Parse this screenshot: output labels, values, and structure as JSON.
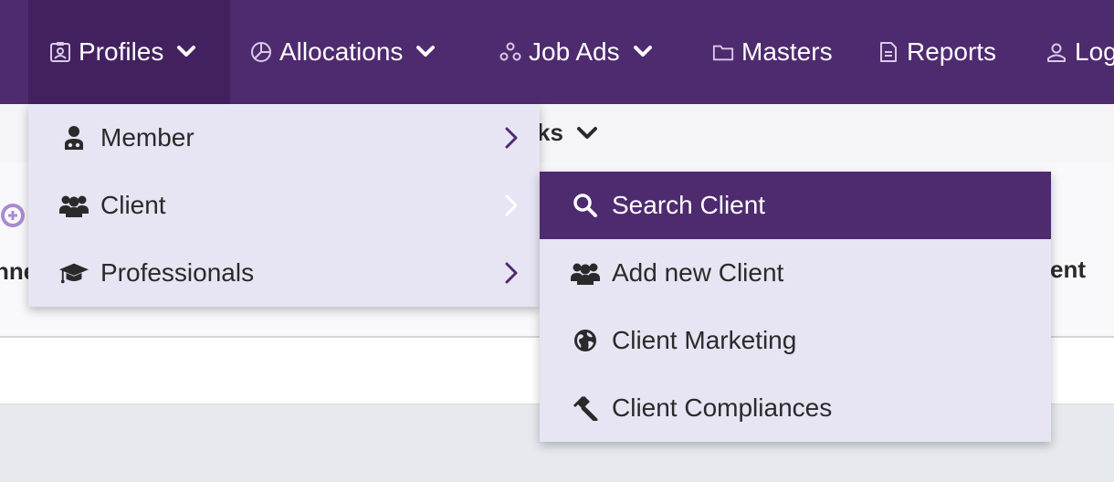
{
  "nav": {
    "items": [
      {
        "label": "Profiles",
        "icon": "profile-badge-icon",
        "has_dropdown": true,
        "active": true
      },
      {
        "label": "Allocations",
        "icon": "pie-chart-icon",
        "has_dropdown": true
      },
      {
        "label": "Job Ads",
        "icon": "nodes-icon",
        "has_dropdown": true
      },
      {
        "label": "Masters",
        "icon": "folder-icon"
      },
      {
        "label": "Reports",
        "icon": "document-icon"
      },
      {
        "label": "Log",
        "icon": "user-icon"
      }
    ]
  },
  "background": {
    "tasks_fragment": "ks",
    "left_fragment": "nne",
    "right_fragment": "ent"
  },
  "menu": {
    "items": [
      {
        "label": "Member",
        "icon": "doctor-icon"
      },
      {
        "label": "Client",
        "icon": "users-icon"
      },
      {
        "label": "Professionals",
        "icon": "graduation-cap-icon"
      }
    ]
  },
  "submenu": {
    "items": [
      {
        "label": "Search Client",
        "icon": "search-icon",
        "active": true
      },
      {
        "label": "Add new Client",
        "icon": "users-icon"
      },
      {
        "label": "Client Marketing",
        "icon": "globe-icon"
      },
      {
        "label": "Client Compliances",
        "icon": "gavel-icon"
      }
    ]
  },
  "colors": {
    "nav_bg": "#4e2a6f",
    "nav_active_bg": "#43215f",
    "menu_bg": "#e7e4f3",
    "accent": "#4e2a6f"
  }
}
